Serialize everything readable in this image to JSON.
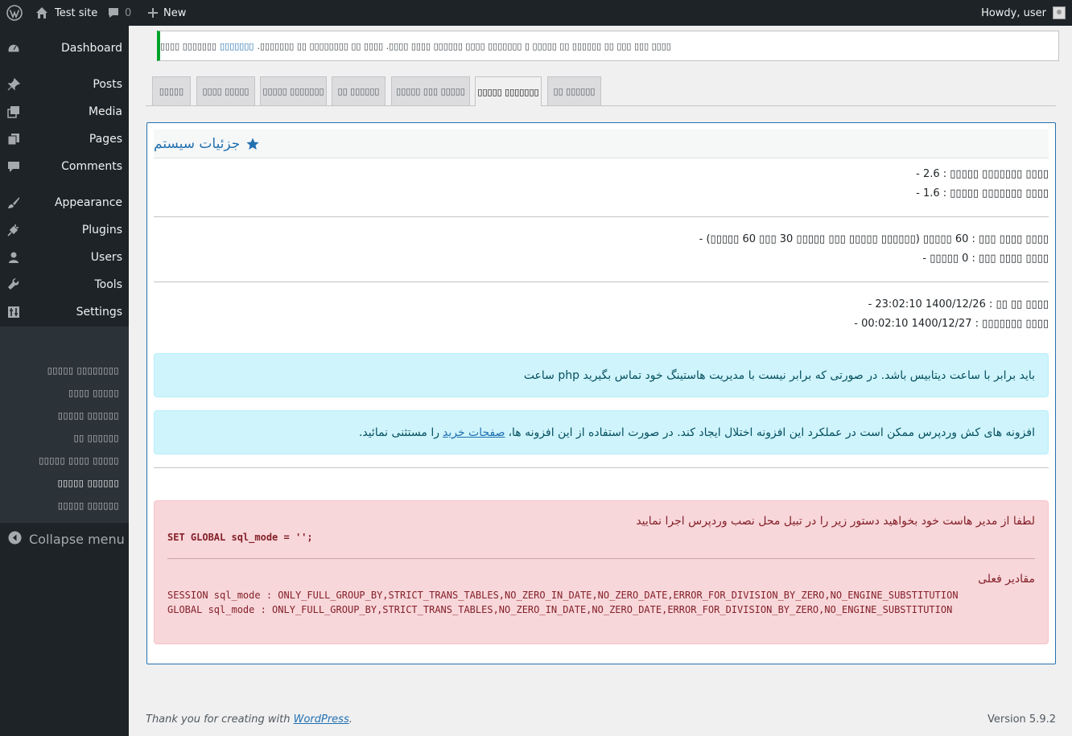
{
  "admin_bar": {
    "site_name": "Test site",
    "comments_count": "0",
    "new_label": "New",
    "howdy": "Howdy, user"
  },
  "sidebar": {
    "items": [
      {
        "label": "Dashboard",
        "icon": "dashboard-icon"
      },
      {
        "label": "Posts",
        "icon": "pin-icon"
      },
      {
        "label": "Media",
        "icon": "media-icon"
      },
      {
        "label": "Pages",
        "icon": "pages-icon"
      },
      {
        "label": "Comments",
        "icon": "comment-icon"
      },
      {
        "label": "Appearance",
        "icon": "brush-icon"
      },
      {
        "label": "Plugins",
        "icon": "plugin-icon"
      },
      {
        "label": "Users",
        "icon": "user-icon"
      },
      {
        "label": "Tools",
        "icon": "wrench-icon"
      },
      {
        "label": "Settings",
        "icon": "settings-icon"
      },
      {
        "label": "▯▯▯▯▯ ▯▯▯▯▯▯▯▯",
        "icon": "cart-icon"
      }
    ],
    "submenu": [
      "▯▯▯▯▯ ▯▯▯▯▯▯▯▯",
      "▯▯▯▯ ▯▯▯▯▯",
      "▯▯▯▯▯ ▯▯▯▯▯▯",
      "▯▯ ▯▯▯▯▯▯",
      "▯▯▯▯▯ ▯▯▯▯ ▯▯▯▯▯",
      "▯▯▯▯▯ ▯▯▯▯▯▯",
      "▯▯▯▯▯ ▯▯▯▯▯▯"
    ],
    "collapse_label": "Collapse menu"
  },
  "notice": {
    "text_before": "▯▯▯▯▯▯▯ ▯▯▯▯",
    "link": "▯▯▯▯▯▯▯",
    "text_after": "▯▯▯▯ ▯▯▯ ▯▯▯ ▯▯ ▯▯▯▯▯▯ ▯▯ ▯▯▯▯▯ ▯ ▯▯▯▯▯▯▯ ▯▯▯▯ ▯▯▯▯▯▯ ▯▯▯▯ ▯▯▯▯. ▯▯▯▯ ▯▯ ▯▯▯▯▯▯▯▯ ▯▯ ▯▯▯▯▯▯▯."
  },
  "tabs": [
    "▯▯▯▯▯",
    "▯▯▯▯ ▯▯▯▯▯",
    "▯▯▯▯▯ ▯▯▯▯▯▯▯",
    "▯▯ ▯▯▯▯▯▯",
    "▯▯▯▯▯ ▯▯▯ ▯▯▯▯▯",
    "▯▯▯▯▯ ▯▯▯▯▯▯▯",
    "▯▯ ▯▯▯▯▯▯"
  ],
  "system": {
    "title": "جزئیات سیستم",
    "lines": [
      "▯▯▯▯ ▯▯▯▯▯▯▯ ▯▯▯▯▯ : 2.6 -",
      "▯▯▯▯ ▯▯▯▯▯▯▯ ▯▯▯▯▯ : 1.6 -",
      "▯▯▯▯ ▯▯▯▯ ▯▯▯ : 60 ▯▯▯▯▯ (▯▯▯▯▯▯ ▯▯▯▯▯ ▯▯▯ ▯▯▯▯▯ 30 ▯▯▯ 60 ▯▯▯▯▯) -",
      "▯▯▯▯ ▯▯▯▯ ▯▯▯ : 0 ▯▯▯▯▯ -",
      "▯▯▯▯ ▯▯ ▯▯ : 1400/12/26 23:02:10 -",
      "▯▯▯▯ ▯▯▯▯▯▯▯ : 1400/12/27 00:02:10 -"
    ],
    "alert1": "باید برابر با ساعت دیتابیس باشد. در صورتی که برابر نیست با مدیریت هاستینگ خود تماس بگیرید php ساعت",
    "alert2_before": "افزونه های کش وردپرس ممکن است در عملکرد این افزونه اختلال ایجاد کند. در صورت استفاده از این افزونه ها،",
    "alert2_link": "صفحات خرید",
    "alert2_after": "را مستثنی نمائید.",
    "danger_text": "لطفا از مدیر هاست خود بخواهید دستور زیر را در تبیل محل نصب وردپرس اجرا نمایید",
    "command": "SET GLOBAL sql_mode = '';",
    "current_values_label": "مقادیر فعلی",
    "session_mode": "SESSION sql_mode : ONLY_FULL_GROUP_BY,STRICT_TRANS_TABLES,NO_ZERO_IN_DATE,NO_ZERO_DATE,ERROR_FOR_DIVISION_BY_ZERO,NO_ENGINE_SUBSTITUTION",
    "global_mode": "GLOBAL sql_mode : ONLY_FULL_GROUP_BY,STRICT_TRANS_TABLES,NO_ZERO_IN_DATE,NO_ZERO_DATE,ERROR_FOR_DIVISION_BY_ZERO,NO_ENGINE_SUBSTITUTION"
  },
  "footer": {
    "thanks_before": "Thank you for creating with",
    "thanks_link": "WordPress",
    "thanks_after": ".",
    "version": "Version 5.9.2"
  },
  "colors": {
    "accent": "#2271b1",
    "sidebar_bg": "#1d2327",
    "success": "#00a32a"
  }
}
